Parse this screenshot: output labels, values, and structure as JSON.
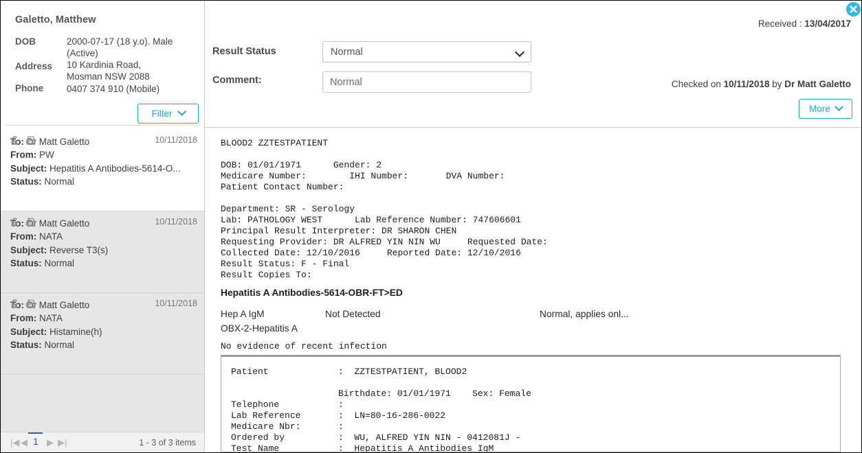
{
  "patient": {
    "name": "Galetto, Matthew",
    "fields": [
      {
        "label": "DOB",
        "value": "2000-07-17 (18 y.o). Male\n(Active)"
      },
      {
        "label": "Address",
        "value": "10 Kardinia Road,\nMosman NSW 2088"
      },
      {
        "label": "Phone",
        "value": "0407 374 910 (Mobile)"
      }
    ],
    "filter_button": "Filter"
  },
  "message_list": {
    "items": [
      {
        "date": "10/11/2018",
        "to_label": "To:",
        "to": "Dr Matt Galetto",
        "from_label": "From:",
        "from": "PW",
        "subject_label": "Subject:",
        "subject": "Hepatitis A Antibodies-5614-O...",
        "status_label": "Status:",
        "status": "Normal",
        "selected": true
      },
      {
        "date": "10/11/2018",
        "to_label": "To:",
        "to": "Dr Matt Galetto",
        "from_label": "From:",
        "from": "NATA",
        "subject_label": "Subject:",
        "subject": "Reverse T3(s)",
        "status_label": "Status:",
        "status": "Normal",
        "selected": false
      },
      {
        "date": "10/11/2018",
        "to_label": "To:",
        "to": "Dr Matt Galetto",
        "from_label": "From:",
        "from": "NATA",
        "subject_label": "Subject:",
        "subject": "Histamine(h)",
        "status_label": "Status:",
        "status": "Normal",
        "selected": false
      }
    ],
    "icons": [
      "lock-icon",
      "fax-icon"
    ]
  },
  "pager": {
    "first": "|◀",
    "prev": "◀",
    "page": "1",
    "next": "▶",
    "last": "▶|",
    "count": "1 - 3 of 3 items"
  },
  "header": {
    "received_label": "Received : ",
    "received_date": "13/04/2017",
    "result_status_label": "Result Status",
    "result_status_value": "Normal",
    "result_status_options": [
      "Normal"
    ],
    "comment_label": "Comment:",
    "comment_value": "Normal",
    "comment_placeholder": "Normal",
    "checked_prefix": "Checked on ",
    "checked_date": "10/11/2018",
    "checked_mid": " by ",
    "checked_by": "Dr Matt Galetto",
    "more_button": "More",
    "close_icon": "close-icon",
    "accent_color": "#1fa8cc",
    "close_color": "#33b9dc"
  },
  "report": {
    "top_text": "BLOOD2 ZZTESTPATIENT\n\nDOB: 01/01/1971      Gender: 2\nMedicare Number:        IHI Number:       DVA Number:\nPatient Contact Number:\n\nDepartment: SR - Serology\nLab: PATHOLOGY WEST      Lab Reference Number: 747606601\nPrincipal Result Interpreter: DR SHARON CHEN\nRequesting Provider: DR ALFRED YIN NIN WU     Requested Date:\nCollected Date: 12/10/2016     Reported Date: 12/10/2016\nResult Status: F - Final\nResult Copies To:",
    "heading": "Hepatitis A Antibodies-5614-OBR-FT>ED",
    "obx_rows": [
      {
        "name": "Hep A IgM",
        "value": "Not Detected",
        "range": "Normal, applies onl..."
      },
      {
        "name": "OBX-2-Hepatitis A",
        "value": "",
        "range": ""
      }
    ],
    "note": "No evidence of recent infection",
    "box_text": "Patient             :  ZZTESTPATIENT, BLOOD2\n\n                    Birthdate: 01/01/1971    Sex: Female\nTelephone           :\nLab Reference       :  LN=80-16-286-0022\nMedicare Nbr:       :\nOrdered by          :  WU, ALFRED YIN NIN - 0412081J -\nTest Name           :  Hepatitis A Antibodies IgM"
  }
}
